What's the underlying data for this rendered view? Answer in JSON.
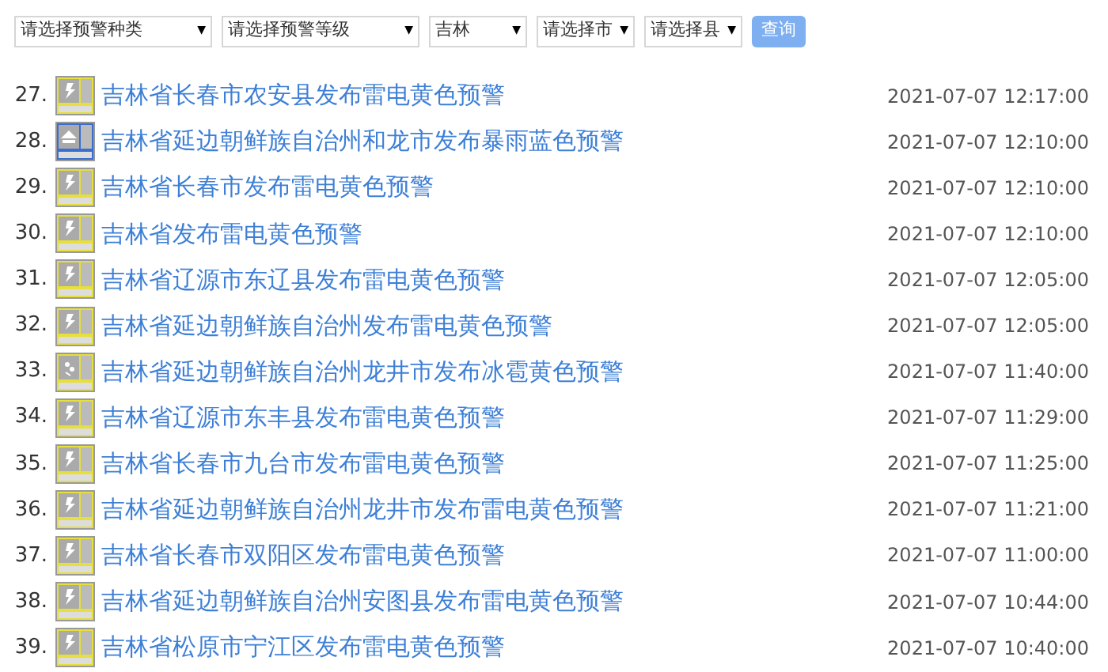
{
  "filters": [
    {
      "value": "请选择预警种类"
    },
    {
      "value": "请选择预警等级"
    },
    {
      "value": "吉林"
    },
    {
      "value": "请选择市"
    },
    {
      "value": "请选择县"
    }
  ],
  "dropdown_arrow": "▼",
  "query_button": "查询",
  "warnings": [
    {
      "number": "27.",
      "kind": "thunder",
      "color": "#e6df3c",
      "title": "吉林省长春市农安县发布雷电黄色预警",
      "time": "2021-07-07 12:17:00"
    },
    {
      "number": "28.",
      "kind": "rainstorm",
      "color": "#3b6fcf",
      "title": "吉林省延边朝鲜族自治州和龙市发布暴雨蓝色预警",
      "time": "2021-07-07 12:10:00"
    },
    {
      "number": "29.",
      "kind": "thunder",
      "color": "#e6df3c",
      "title": "吉林省长春市发布雷电黄色预警",
      "time": "2021-07-07 12:10:00"
    },
    {
      "number": "30.",
      "kind": "thunder",
      "color": "#e6df3c",
      "title": "吉林省发布雷电黄色预警",
      "time": "2021-07-07 12:10:00"
    },
    {
      "number": "31.",
      "kind": "thunder",
      "color": "#e6df3c",
      "title": "吉林省辽源市东辽县发布雷电黄色预警",
      "time": "2021-07-07 12:05:00"
    },
    {
      "number": "32.",
      "kind": "thunder",
      "color": "#e6df3c",
      "title": "吉林省延边朝鲜族自治州发布雷电黄色预警",
      "time": "2021-07-07 12:05:00"
    },
    {
      "number": "33.",
      "kind": "hail",
      "color": "#e6df3c",
      "title": "吉林省延边朝鲜族自治州龙井市发布冰雹黄色预警",
      "time": "2021-07-07 11:40:00"
    },
    {
      "number": "34.",
      "kind": "thunder",
      "color": "#e6df3c",
      "title": "吉林省辽源市东丰县发布雷电黄色预警",
      "time": "2021-07-07 11:29:00"
    },
    {
      "number": "35.",
      "kind": "thunder",
      "color": "#e6df3c",
      "title": "吉林省长春市九台市发布雷电黄色预警",
      "time": "2021-07-07 11:25:00"
    },
    {
      "number": "36.",
      "kind": "thunder",
      "color": "#e6df3c",
      "title": "吉林省延边朝鲜族自治州龙井市发布雷电黄色预警",
      "time": "2021-07-07 11:21:00"
    },
    {
      "number": "37.",
      "kind": "thunder",
      "color": "#e6df3c",
      "title": "吉林省长春市双阳区发布雷电黄色预警",
      "time": "2021-07-07 11:00:00"
    },
    {
      "number": "38.",
      "kind": "thunder",
      "color": "#e6df3c",
      "title": "吉林省延边朝鲜族自治州安图县发布雷电黄色预警",
      "time": "2021-07-07 10:44:00"
    },
    {
      "number": "39.",
      "kind": "thunder",
      "color": "#e6df3c",
      "title": "吉林省松原市宁江区发布雷电黄色预警",
      "time": "2021-07-07 10:40:00"
    }
  ]
}
